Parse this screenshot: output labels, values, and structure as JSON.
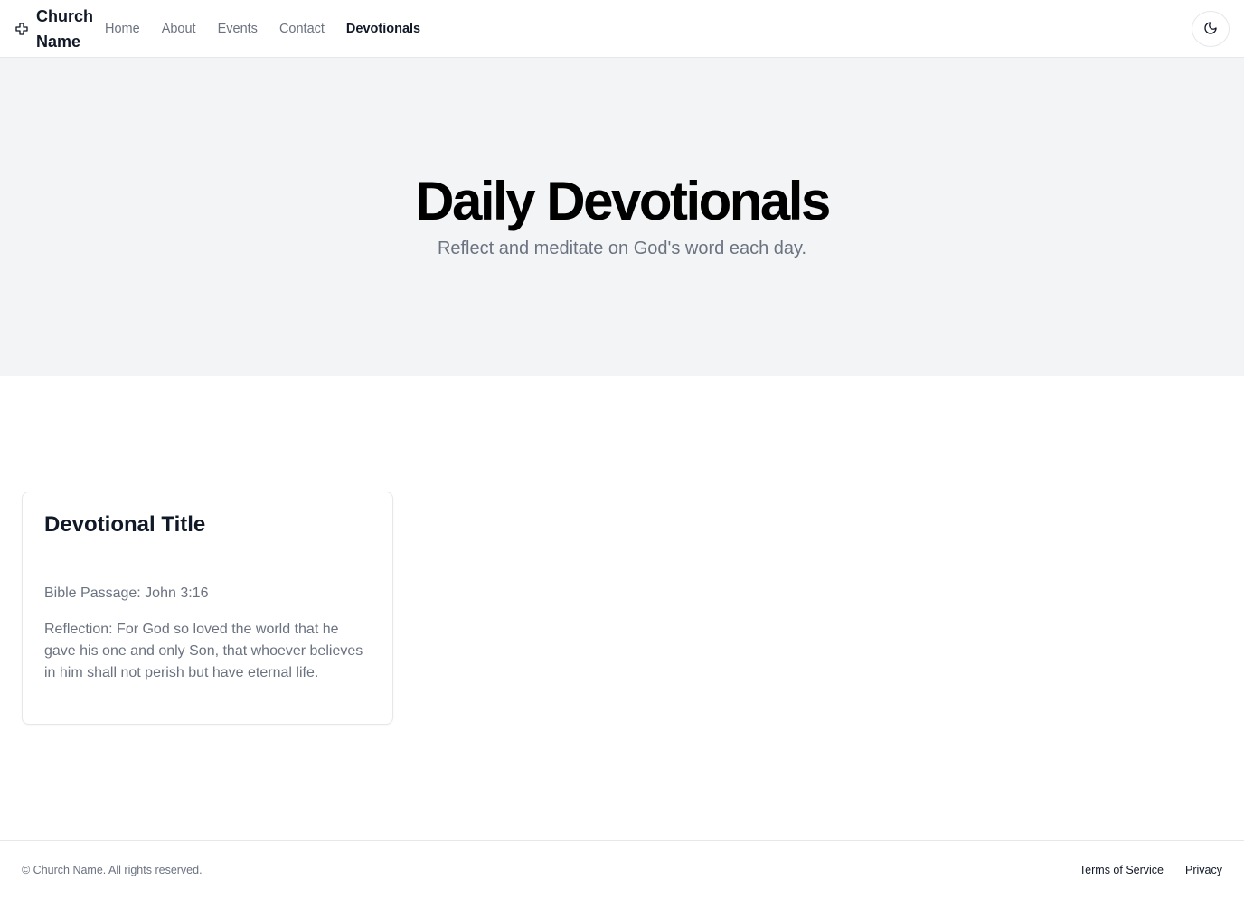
{
  "header": {
    "brand_name": "Church Name",
    "brand_icon": "cross-icon",
    "nav": [
      {
        "label": "Home",
        "active": false
      },
      {
        "label": "About",
        "active": false
      },
      {
        "label": "Events",
        "active": false
      },
      {
        "label": "Contact",
        "active": false
      },
      {
        "label": "Devotionals",
        "active": true
      }
    ],
    "theme_toggle_icon": "moon-icon"
  },
  "hero": {
    "title": "Daily Devotionals",
    "subtitle": "Reflect and meditate on God's word each day."
  },
  "devotionals": [
    {
      "title": "Devotional Title",
      "passage": "Bible Passage: John 3:16",
      "reflection": "Reflection: For God so loved the world that he gave his one and only Son, that whoever believes in him shall not perish but have eternal life."
    }
  ],
  "footer": {
    "copyright": "© Church Name. All rights reserved.",
    "links": [
      "Terms of Service",
      "Privacy"
    ]
  },
  "colors": {
    "hero_background": "#f3f4f6",
    "text_primary": "#111827",
    "text_muted": "#6b7280",
    "border": "#e5e7eb"
  }
}
